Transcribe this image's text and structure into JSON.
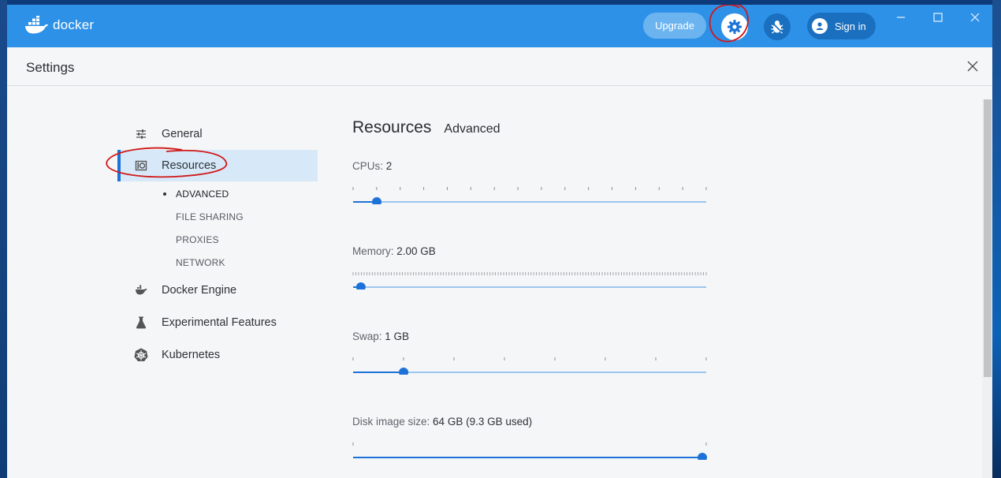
{
  "app": {
    "logo_text": "docker"
  },
  "titlebar": {
    "upgrade_label": "Upgrade",
    "signin_label": "Sign in",
    "brand_color": "#2e91e8"
  },
  "settings": {
    "title": "Settings"
  },
  "sidebar": {
    "items": [
      {
        "label": "General",
        "icon": "sliders-icon"
      },
      {
        "label": "Resources",
        "icon": "disk-icon",
        "active": true
      },
      {
        "label": "Docker Engine",
        "icon": "whale-icon"
      },
      {
        "label": "Experimental Features",
        "icon": "flask-icon"
      },
      {
        "label": "Kubernetes",
        "icon": "helm-icon"
      }
    ],
    "resources_subnav": [
      "ADVANCED",
      "FILE SHARING",
      "PROXIES",
      "NETWORK"
    ]
  },
  "main": {
    "title": "Resources",
    "subtitle": "Advanced",
    "resources": [
      {
        "label": "CPUs:",
        "value": "2",
        "fraction": 0.067,
        "ticks": 16
      },
      {
        "label": "Memory:",
        "value": "2.00 GB",
        "fraction": 0.022,
        "ticks": 130
      },
      {
        "label": "Swap:",
        "value": "1 GB",
        "fraction": 0.143,
        "ticks": 8
      },
      {
        "label": "Disk image size:",
        "value": "64 GB (9.3 GB used)",
        "fraction": 1.0,
        "ticks": 2
      }
    ],
    "accent_color": "#1d72d8"
  }
}
